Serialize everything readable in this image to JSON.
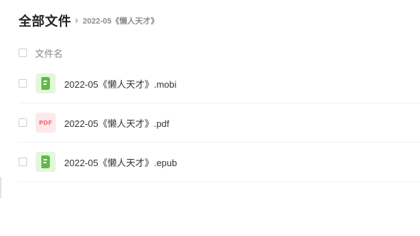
{
  "header": {
    "title": "全部文件",
    "breadcrumb_current": "2022-05《懒人天才》"
  },
  "list_header": {
    "name_column": "文件名"
  },
  "files": [
    {
      "name": "2022-05《懒人天才》.mobi",
      "icon": "book-icon",
      "icon_text": ""
    },
    {
      "name": "2022-05《懒人天才》.pdf",
      "icon": "pdf-icon",
      "icon_text": "PDF"
    },
    {
      "name": "2022-05《懒人天才》.epub",
      "icon": "book-icon",
      "icon_text": ""
    }
  ],
  "colors": {
    "book_icon_bg": "#e4f6dc",
    "book_icon_fg": "#5fb94a",
    "pdf_icon_bg": "#fde9ea",
    "pdf_icon_fg": "#f06b74"
  }
}
